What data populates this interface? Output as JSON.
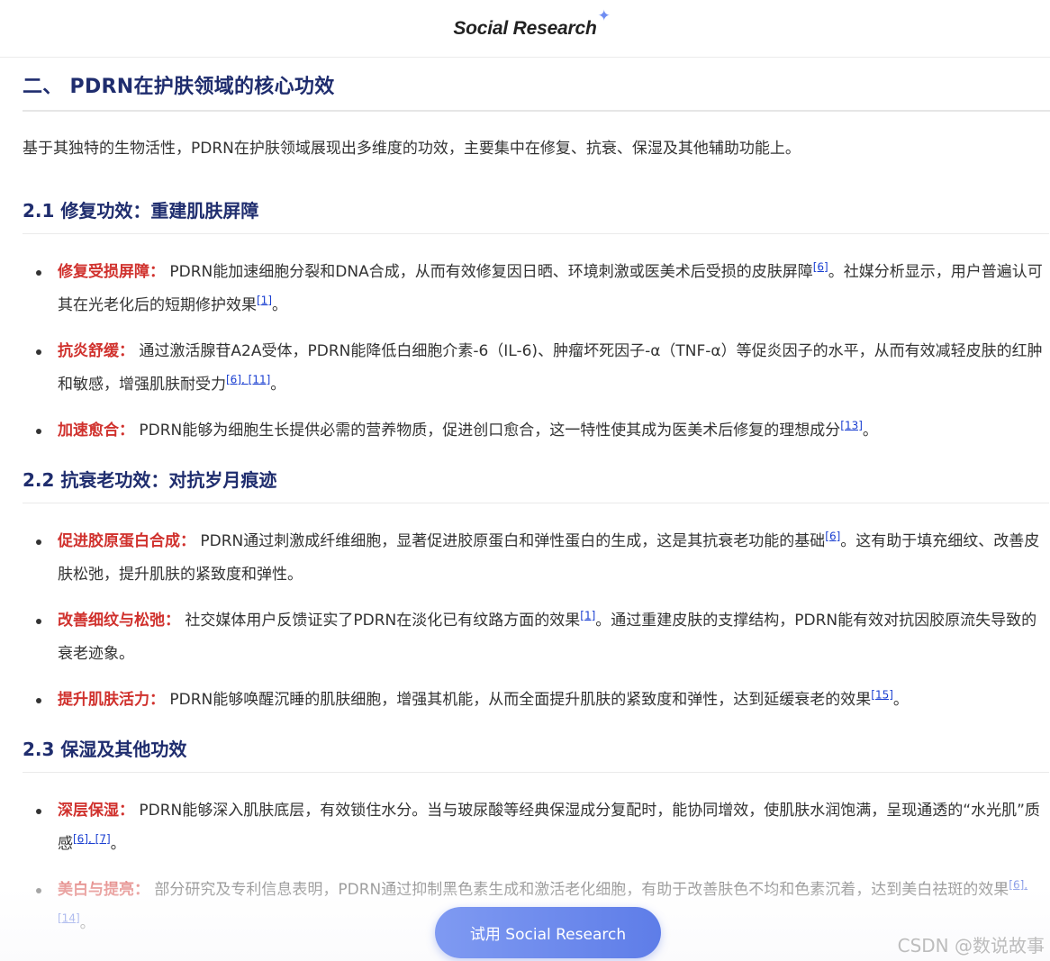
{
  "header": {
    "brand": "Social Research",
    "star": "✦"
  },
  "section": {
    "title": "二、 PDRN在护肤领域的核心功效"
  },
  "intro": "基于其独特的生物活性，PDRN在护肤领域展现出多维度的功效，主要集中在修复、抗衰、保湿及其他辅助功能上。",
  "s21": {
    "title": "2.1 修复功效：重建肌肤屏障",
    "items": [
      {
        "kw": "修复受损屏障：",
        "t1": " PDRN能加速细胞分裂和DNA合成，从而有效修复因日晒、环境刺激或医美术后受损的皮肤屏障",
        "r1": "[6]",
        "t2": "。社媒分析显示，用户普遍认可其在光老化后的短期修护效果",
        "r2": "[1]",
        "t3": "。"
      },
      {
        "kw": "抗炎舒缓：",
        "t1": " 通过激活腺苷A2A受体，PDRN能降低白细胞介素-6（IL-6)、肿瘤坏死因子-α（TNF-α）等促炎因子的水平，从而有效减轻皮肤的红肿和敏感，增强肌肤耐受力",
        "r1": "[6]",
        "t2": ", ",
        "r2": "[11]",
        "t3": "。"
      },
      {
        "kw": "加速愈合：",
        "t1": " PDRN能够为细胞生长提供必需的营养物质，促进创口愈合，这一特性使其成为医美术后修复的理想成分",
        "r1": "[13]",
        "t2": "。"
      }
    ]
  },
  "s22": {
    "title": "2.2 抗衰老功效：对抗岁月痕迹",
    "items": [
      {
        "kw": "促进胶原蛋白合成：",
        "t1": " PDRN通过刺激成纤维细胞，显著促进胶原蛋白和弹性蛋白的生成，这是其抗衰老功能的基础",
        "r1": "[6]",
        "t2": "。这有助于填充细纹、改善皮肤松弛，提升肌肤的紧致度和弹性。"
      },
      {
        "kw": "改善细纹与松弛：",
        "t1": " 社交媒体用户反馈证实了PDRN在淡化已有纹路方面的效果",
        "r1": "[1]",
        "t2": "。通过重建皮肤的支撑结构，PDRN能有效对抗因胶原流失导致的衰老迹象。"
      },
      {
        "kw": "提升肌肤活力：",
        "t1": " PDRN能够唤醒沉睡的肌肤细胞，增强其机能，从而全面提升肌肤的紧致度和弹性，达到延缓衰老的效果",
        "r1": "[15]",
        "t2": "。"
      }
    ]
  },
  "s23": {
    "title": "2.3 保湿及其他功效",
    "items": [
      {
        "kw": "深层保湿：",
        "t1": " PDRN能够深入肌肤底层，有效锁住水分。当与玻尿酸等经典保湿成分复配时，能协同增效，使肌肤水润饱满，呈现通透的“水光肌”质感",
        "r1": "[6]",
        "t2": ", ",
        "r2": "[7]",
        "t3": "。"
      },
      {
        "kw": "美白与提亮：",
        "t1": " 部分研究及专利信息表明，PDRN通过抑制黑色素生成和激活老化细胞，有助于改善肤色不均和色素沉着，达到美白祛斑的效果",
        "r1": "[6]",
        "t2": ", ",
        "r2": "[14]",
        "t3": "。"
      }
    ]
  },
  "cta": {
    "label": "试用 Social Research"
  },
  "watermark": "CSDN @数说故事"
}
